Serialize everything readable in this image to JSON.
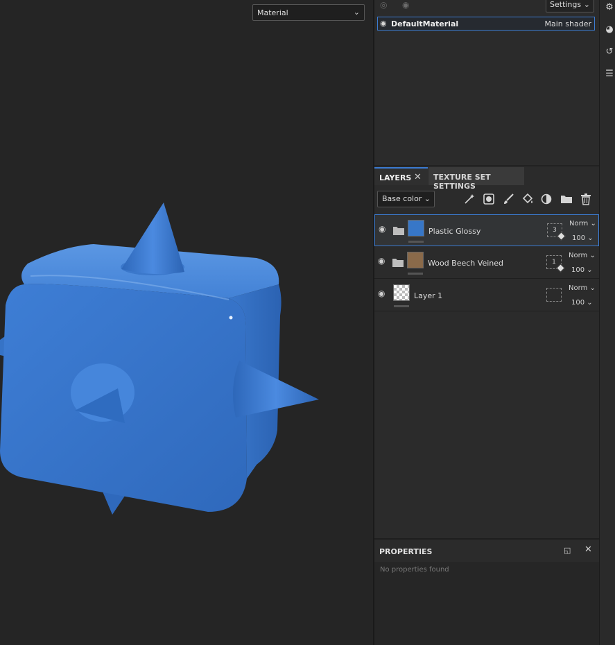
{
  "viewport": {
    "mode_select": "Material",
    "chevron_icon": "chevron-down-icon"
  },
  "texture_set_list": {
    "settings_label": "Settings",
    "row": {
      "name": "DefaultMaterial",
      "shader": "Main shader"
    }
  },
  "layers_panel": {
    "tabs": [
      {
        "label": "LAYERS",
        "active": true
      },
      {
        "label": "TEXTURE SET SETTINGS",
        "active": false
      }
    ],
    "channel_select": "Base color",
    "tools": [
      "magic-wand-icon",
      "mask-icon",
      "paint-brush-icon",
      "fill-bucket-icon",
      "smart-material-icon",
      "folder-icon",
      "trash-icon"
    ],
    "layers": [
      {
        "name": "Plastic Glossy",
        "type": "folder",
        "selected": true,
        "mask_count": "3",
        "blend": "Norm",
        "opacity": "100",
        "thumb_color": "#3777c8"
      },
      {
        "name": "Wood Beech Veined",
        "type": "folder",
        "selected": false,
        "mask_count": "1",
        "blend": "Norm",
        "opacity": "100",
        "thumb_color": "#8a6a4a"
      },
      {
        "name": "Layer 1",
        "type": "layer",
        "selected": false,
        "mask_count": "",
        "blend": "Norm",
        "opacity": "100",
        "thumb_color": "checker"
      }
    ]
  },
  "properties_panel": {
    "title": "PROPERTIES",
    "empty_message": "No properties found"
  },
  "colors": {
    "accent": "#3b7bd1",
    "object_blue": "#3d7dd4",
    "background": "#252525"
  }
}
